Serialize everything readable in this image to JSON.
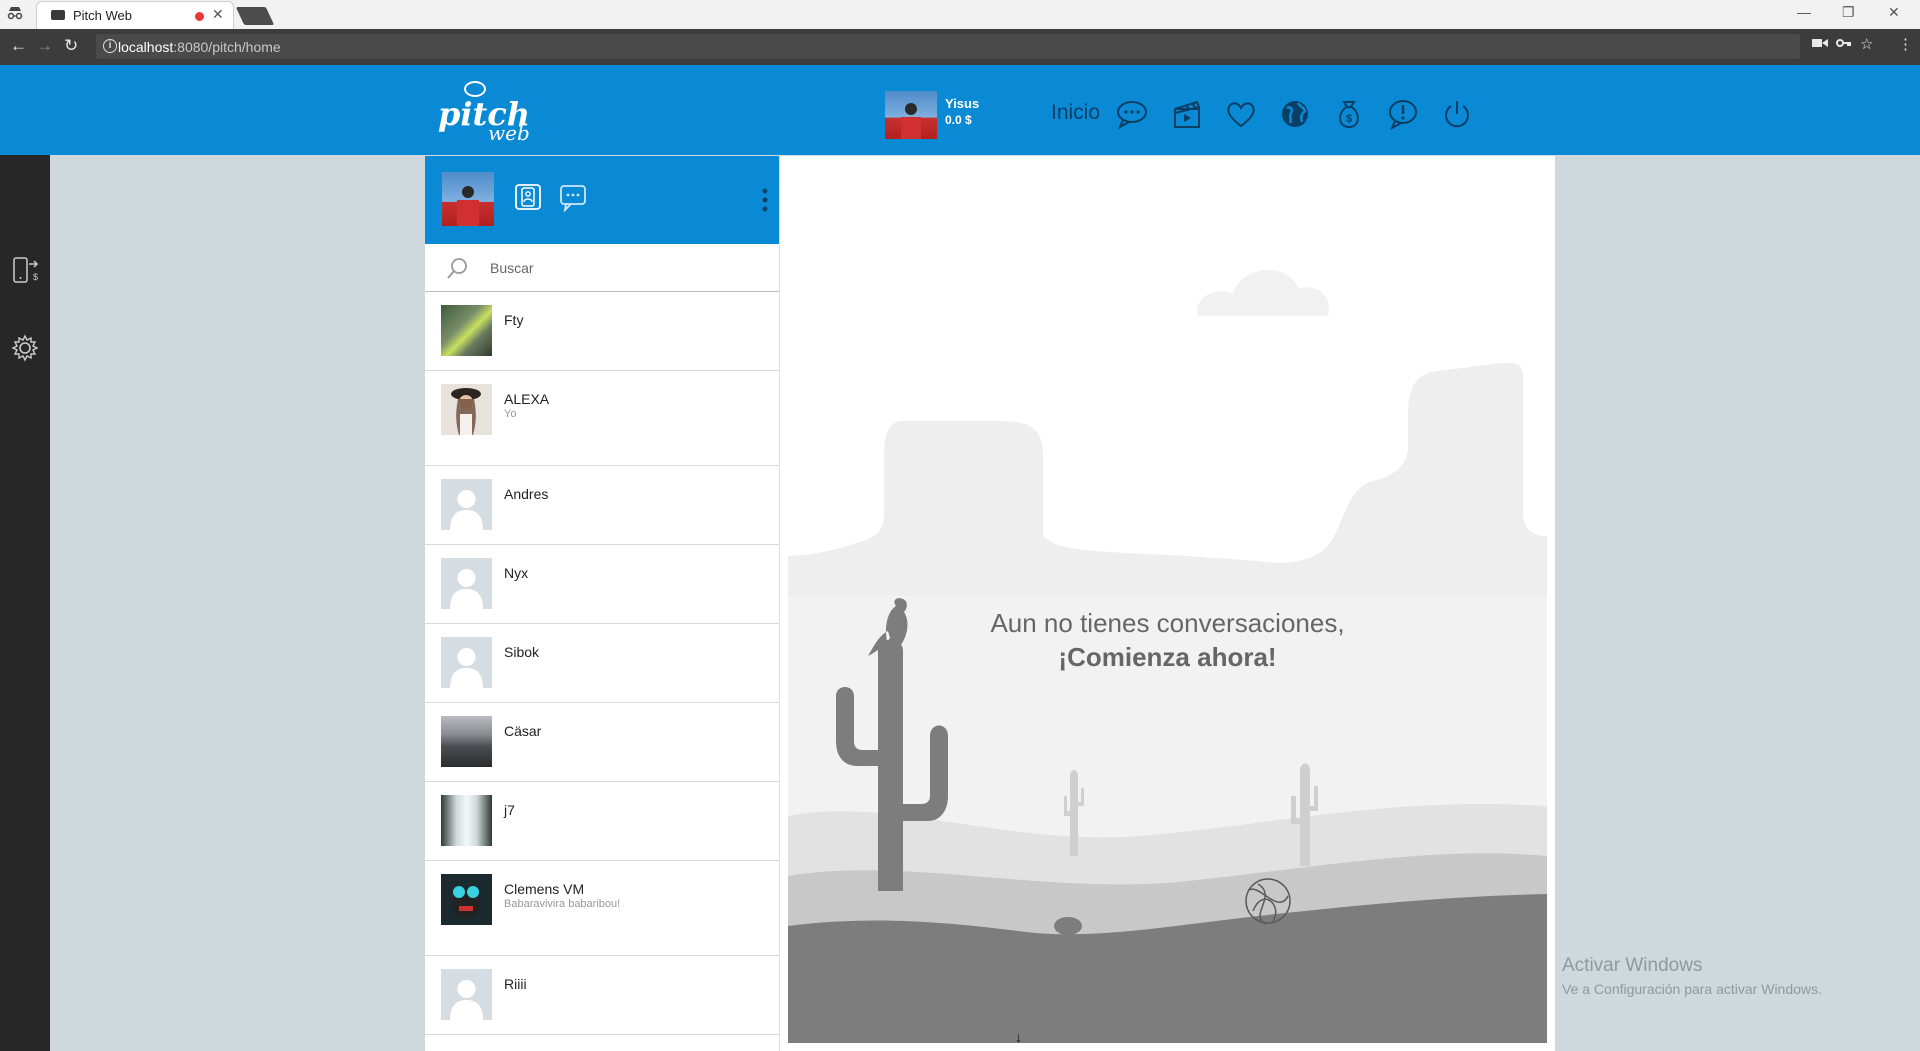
{
  "browser": {
    "tab_title": "Pitch Web",
    "url_host": "localhost",
    "url_rest": ":8080/pitch/home",
    "icons": [
      "incognito-icon",
      "back-icon",
      "forward-icon",
      "reload-icon",
      "info-icon",
      "camera-icon",
      "key-icon",
      "star-icon",
      "menu-icon"
    ]
  },
  "header": {
    "logo_main": "pitch",
    "logo_sub": "web",
    "user_name": "Yisus",
    "balance": "0.0 $",
    "nav_label": "Inicio",
    "nav_icons": [
      "chat-icon",
      "clapperboard-icon",
      "heart-icon",
      "globe-icon",
      "money-bag-icon",
      "alert-icon",
      "power-icon"
    ]
  },
  "leftbar": {
    "icons": [
      "phone-money-icon",
      "gear-icon"
    ]
  },
  "chat_panel": {
    "icons": [
      "contacts-icon",
      "chat-bubble-icon",
      "more-vert-icon"
    ],
    "search_placeholder": "Buscar",
    "contacts": [
      {
        "name": "Fty",
        "status": ""
      },
      {
        "name": "ALEXA",
        "status": "Yo"
      },
      {
        "name": "Andres",
        "status": ""
      },
      {
        "name": "Nyx",
        "status": ""
      },
      {
        "name": "Sibok",
        "status": ""
      },
      {
        "name": "Cäsar",
        "status": ""
      },
      {
        "name": "j7",
        "status": ""
      },
      {
        "name": "Clemens VM",
        "status": "Babaravivira babaribou!"
      },
      {
        "name": "Riiii",
        "status": ""
      }
    ]
  },
  "conversation": {
    "empty_line1": "Aun no tienes conversaciones,",
    "empty_line2": "¡Comienza ahora!"
  },
  "watermark": {
    "title": "Activar Windows",
    "subtitle": "Ve a Configuración para activar Windows."
  },
  "colors": {
    "brand_blue": "#0a89d4",
    "dark_sidebar": "#272727",
    "page_bg": "#cfd8dc"
  }
}
